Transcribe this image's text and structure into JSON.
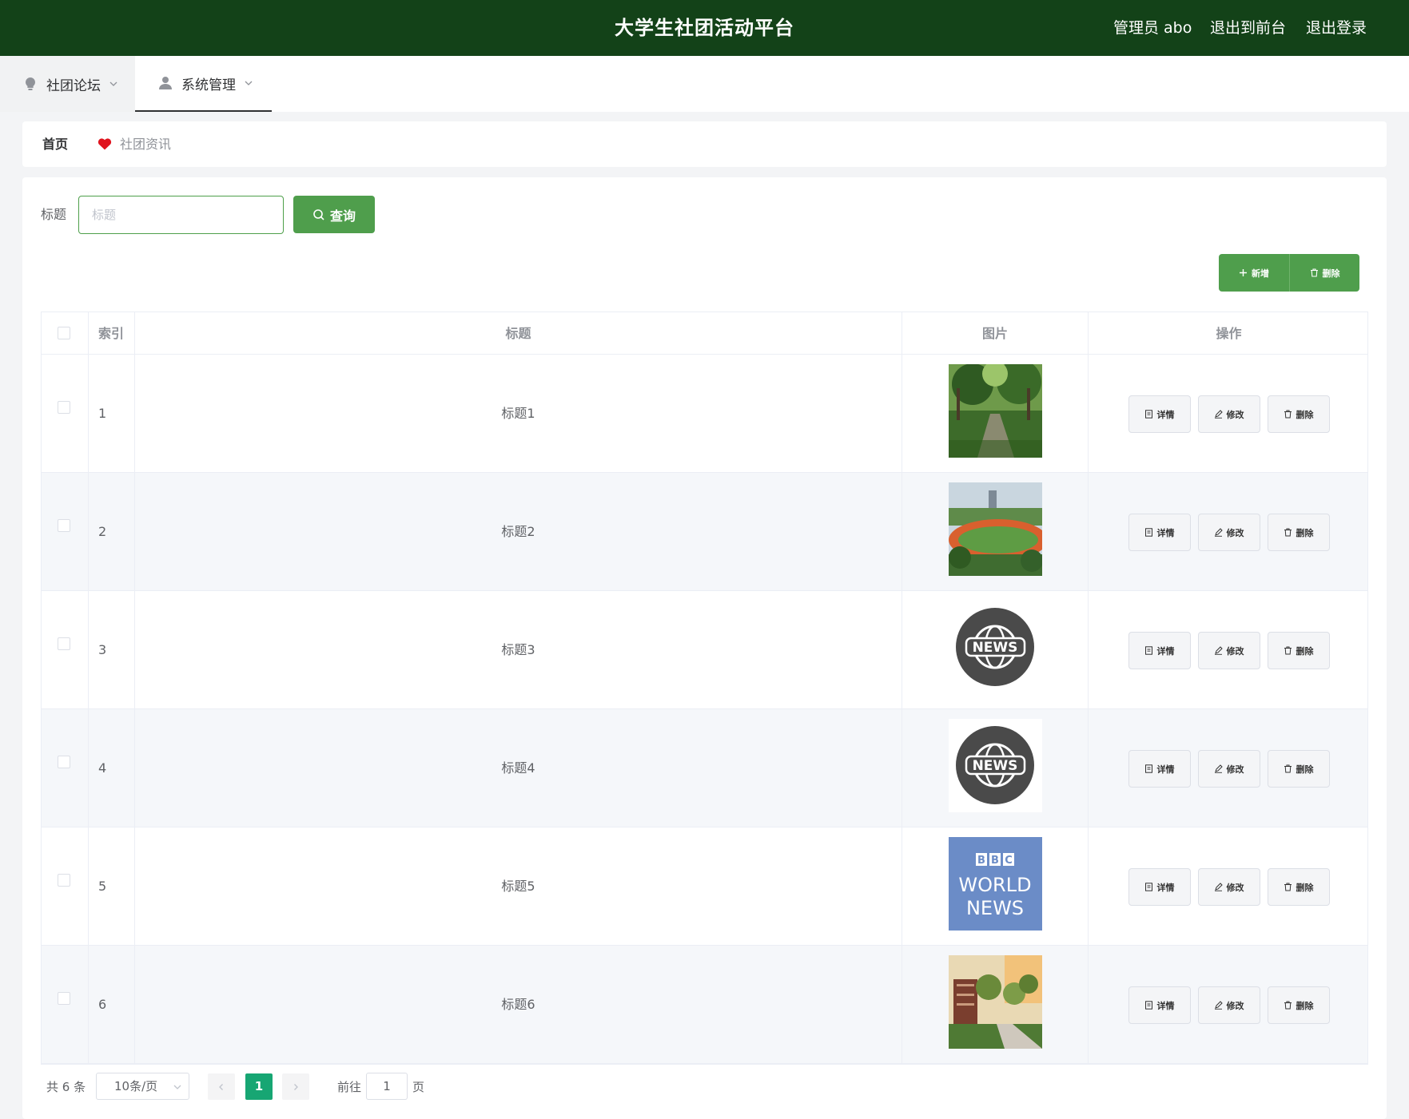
{
  "header": {
    "title": "大学生社团活动平台",
    "user": "管理员 abo",
    "to_front": "退出到前台",
    "logout": "退出登录",
    "bg_color": "#134218"
  },
  "menu": [
    {
      "label": "社团论坛",
      "icon": "bulb-icon"
    },
    {
      "label": "系统管理",
      "icon": "user-icon"
    }
  ],
  "breadcrumb": {
    "home": "首页",
    "current": "社团资讯",
    "separator_icon": "heart-icon"
  },
  "search": {
    "label": "标题",
    "placeholder": "标题",
    "value": "",
    "button": "查询"
  },
  "actions": {
    "add": "新增",
    "delete": "删除"
  },
  "table": {
    "columns": [
      "索引",
      "标题",
      "图片",
      "操作"
    ],
    "rows": [
      {
        "index": "1",
        "title": "标题1",
        "image": "campus-path-photo"
      },
      {
        "index": "2",
        "title": "标题2",
        "image": "sports-field-photo"
      },
      {
        "index": "3",
        "title": "标题3",
        "image": "news-globe-logo"
      },
      {
        "index": "4",
        "title": "标题4",
        "image": "news-globe-logo"
      },
      {
        "index": "5",
        "title": "标题5",
        "image": "bbc-world-news-logo"
      },
      {
        "index": "6",
        "title": "标题6",
        "image": "campus-building-photo"
      }
    ],
    "row_ops": {
      "detail": "详情",
      "edit": "修改",
      "delete": "删除"
    }
  },
  "images": {
    "news_text": "NEWS",
    "bbc_letters": [
      "B",
      "B",
      "C"
    ],
    "bbc_line1": "WORLD",
    "bbc_line2": "NEWS"
  },
  "pagination": {
    "total": "共 6 条",
    "page_size": "10条/页",
    "current_page": "1",
    "goto_label": "前往",
    "goto_value": "1",
    "page_suffix": "页"
  },
  "colors": {
    "accent": "#4f9e4c",
    "pager_active": "#17a673",
    "heart": "#e0141e"
  }
}
